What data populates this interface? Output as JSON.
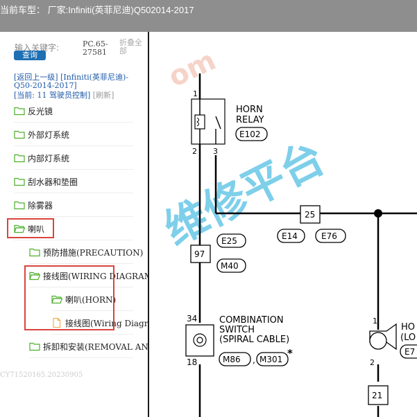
{
  "window": {
    "title": "当前车型： 厂家:Infiniti(英菲尼迪)Q502014-2017"
  },
  "search": {
    "label": "输入关键字:",
    "button": "查询",
    "pc_code": "PC.65-27581",
    "collapse": "折叠全部"
  },
  "nav": {
    "back": "[返回上一级] [Infiniti(英菲尼迪)-Q50-2014-2017]",
    "current_prefix": "[当前:",
    "current_code": "11",
    "current_name": "驾驶员控制]",
    "refresh": "[刷新]"
  },
  "tree": [
    {
      "label": "反光镜",
      "level": 0,
      "type": "folder"
    },
    {
      "label": "外部灯系统",
      "level": 0,
      "type": "folder"
    },
    {
      "label": "内部灯系统",
      "level": 0,
      "type": "folder"
    },
    {
      "label": "刮水器和垫圈",
      "level": 0,
      "type": "folder"
    },
    {
      "label": "除雾器",
      "level": 0,
      "type": "folder"
    },
    {
      "label": "喇叭",
      "level": 0,
      "type": "folder-open"
    },
    {
      "label": "预防措施(PRECAUTION)",
      "level": 1,
      "type": "folder"
    },
    {
      "label": "接线图(WIRING DIAGRAM)",
      "level": 1,
      "type": "folder-open"
    },
    {
      "label": "喇叭(HORN)",
      "level": 2,
      "type": "folder-open"
    },
    {
      "label": "接线图(Wiring Diagram)",
      "level": 2,
      "type": "document"
    },
    {
      "label": "拆卸和安装(REMOVAL AND INSTALLATION)",
      "level": 1,
      "type": "folder"
    }
  ],
  "serial": "CY71520165.20230905",
  "diagram": {
    "watermark_fragment": "om",
    "watermark_text": "维修平台",
    "horn_relay_name": "HORN",
    "horn_relay_name2": "RELAY",
    "horn_relay_connector": "E102",
    "pin_1": "1",
    "pin_2": "2",
    "pin_3": "3",
    "junction_25": "25",
    "conn_e14": "E14",
    "conn_e76": "E76",
    "conn_e25": "E25",
    "junction_97": "97",
    "conn_m40": "M40",
    "switch_name": "COMBINATION",
    "switch_name2": "SWITCH",
    "switch_name3": "(SPIRAL CABLE)",
    "pin_34": "34",
    "pin_18": "18",
    "conn_m86": "M86",
    "conn_m301": "M301",
    "conn_sep": ",",
    "star": "*",
    "horn_fragment": "HO",
    "horn_fragment2": "(LO",
    "conn_e7_fragment": "E7",
    "pin_1b": "1",
    "pin_2b": "2",
    "junction_21": "21"
  },
  "colors": {
    "titlebar": "#8e8e8e",
    "link": "#1e5aa8",
    "button": "#1e6fb3",
    "highlight": "#d9443d",
    "folder": "#4caf2a",
    "watermark": "#5ec4e6"
  }
}
